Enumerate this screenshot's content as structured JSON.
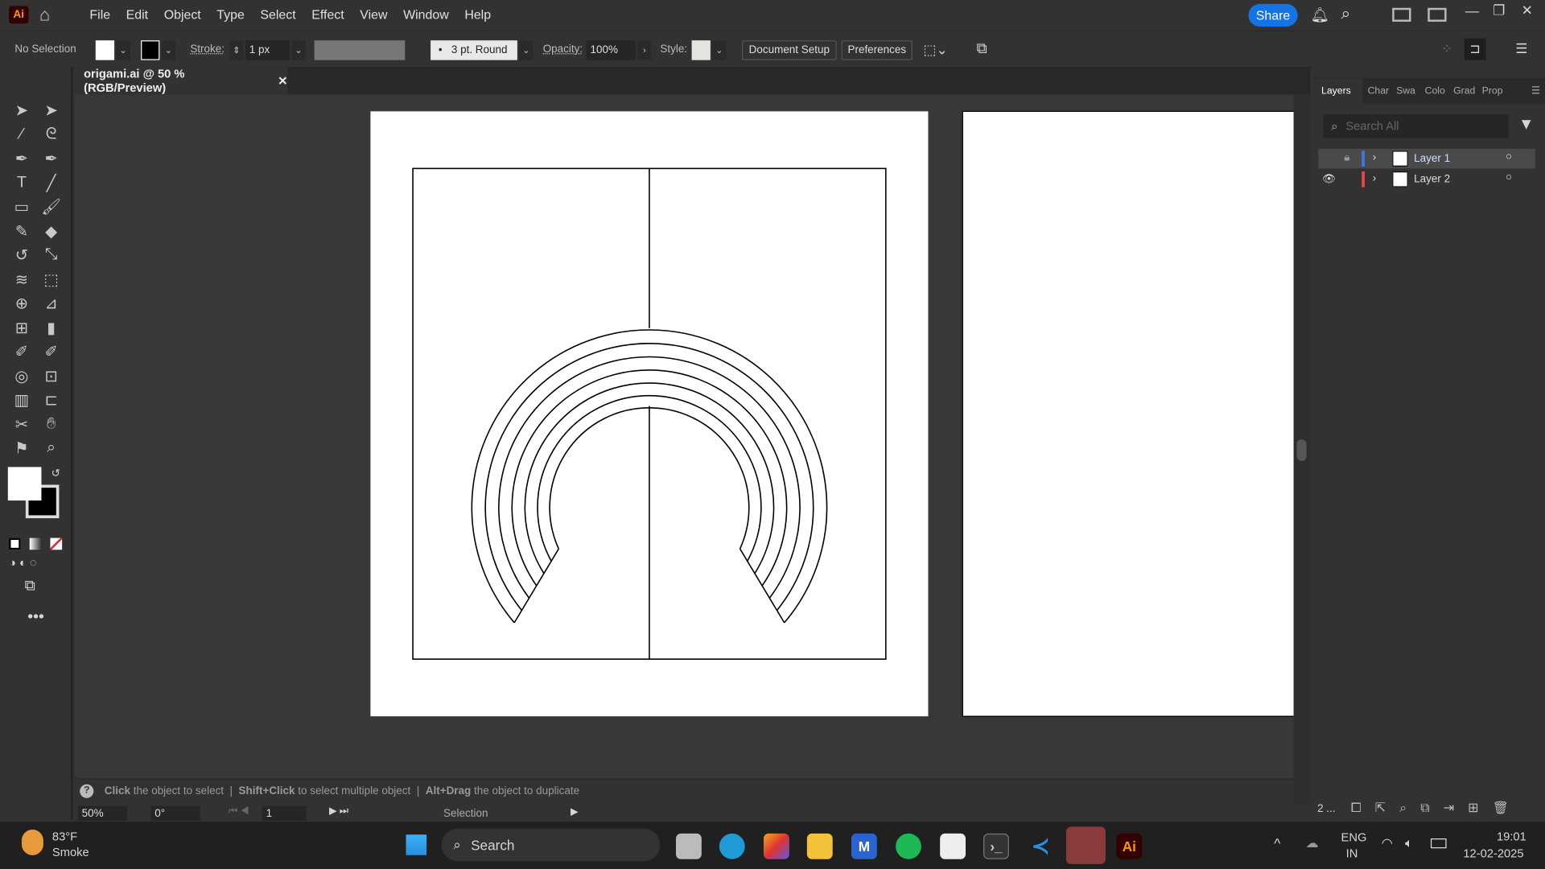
{
  "app": {
    "logo": "Ai",
    "menu": [
      "File",
      "Edit",
      "Object",
      "Type",
      "Select",
      "Effect",
      "View",
      "Window",
      "Help"
    ],
    "share": "Share"
  },
  "control": {
    "selection": "No Selection",
    "stroke_label": "Stroke:",
    "stroke_value": "1 px",
    "brush": "3 pt. Round",
    "opacity_label": "Opacity:",
    "opacity_value": "100%",
    "style_label": "Style:",
    "document_setup": "Document Setup",
    "preferences": "Preferences"
  },
  "document": {
    "tab_title": "origami.ai @ 50 % (RGB/Preview)"
  },
  "tools": [
    "selection-icon",
    "direct-selection-icon",
    "magic-wand-icon",
    "lasso-icon",
    "pen-icon",
    "curvature-icon",
    "type-icon",
    "line-icon",
    "rectangle-icon",
    "paintbrush-icon",
    "shaper-icon",
    "eraser-icon",
    "rotate-icon",
    "scale-icon",
    "warp-icon",
    "free-transform-icon",
    "shape-builder-icon",
    "perspective-grid-icon",
    "mesh-icon",
    "gradient-icon",
    "eyedropper-icon",
    "measure-icon",
    "blend-icon",
    "symbol-sprayer-icon",
    "column-graph-icon",
    "artboard-icon",
    "slice-icon",
    "hand-icon",
    "puppet-warp-icon",
    "zoom-icon"
  ],
  "panel": {
    "tabs": [
      "Layers",
      "Char",
      "Swa",
      "Colo",
      "Grad",
      "Prop"
    ],
    "search_placeholder": "Search All",
    "layers": [
      {
        "name": "Layer 1",
        "color": "#3b7ae8",
        "selected": true
      },
      {
        "name": "Layer 2",
        "color": "#e84a4a",
        "selected": false
      }
    ],
    "layer_count": "2 ..."
  },
  "status": {
    "hint_1_bold": "Click",
    "hint_1": " the object to select",
    "hint_2_bold": "Shift+Click",
    "hint_2": " to select multiple object",
    "hint_3_bold": "Alt+Drag",
    "hint_3": " the object to duplicate",
    "zoom": "50%",
    "rotation": "0°",
    "artboard": "1",
    "mode": "Selection"
  },
  "taskbar": {
    "temp": "83°F",
    "weather": "Smoke",
    "search": "Search",
    "lang1": "ENG",
    "lang2": "IN",
    "time": "19:01",
    "date": "12-02-2025"
  },
  "colors": {
    "accent": "#1473e6"
  }
}
